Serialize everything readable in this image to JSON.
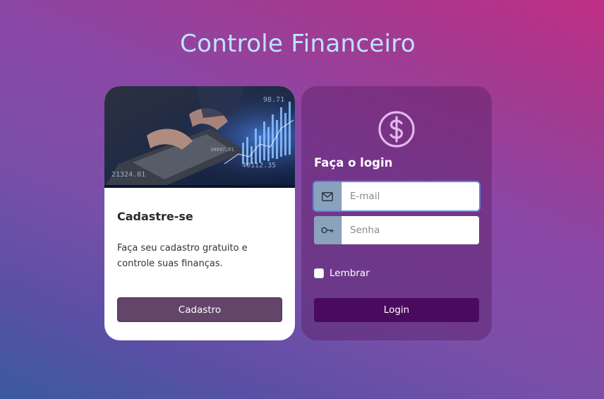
{
  "page": {
    "title": "Controle Financeiro"
  },
  "signup": {
    "title": "Cadastre-se",
    "text": "Faça seu cadastro gratuito e controle suas finanças.",
    "button_label": "Cadastro",
    "image_icon": "finance-trading-image"
  },
  "login": {
    "logo_icon": "dollar-circle-icon",
    "title": "Faça o login",
    "email": {
      "icon": "envelope-icon",
      "placeholder": "E-mail",
      "value": ""
    },
    "password": {
      "icon": "key-icon",
      "placeholder": "Senha",
      "value": ""
    },
    "remember_label": "Lembrar",
    "remember_checked": false,
    "button_label": "Login"
  },
  "colors": {
    "title": "#bfe3ff",
    "signup_button": "#624569",
    "login_button": "#4a0b5e",
    "input_addon": "#8aa2bc"
  }
}
